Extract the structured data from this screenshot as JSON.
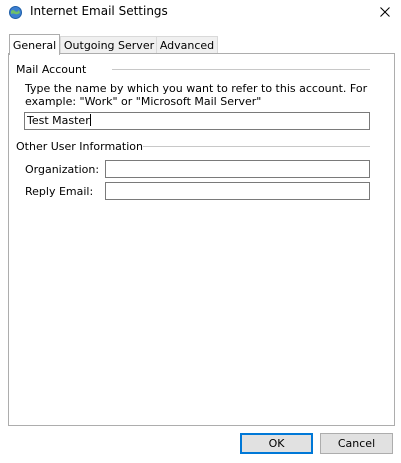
{
  "window": {
    "title": "Internet Email Settings",
    "icon": "globe-mail-icon",
    "close": "close-icon"
  },
  "tabs": [
    {
      "label": "General",
      "active": true
    },
    {
      "label": "Outgoing Server",
      "active": false
    },
    {
      "label": "Advanced",
      "active": false
    }
  ],
  "mail_account": {
    "heading": "Mail Account",
    "description": "Type the name by which you want to refer to this account. For example: \"Work\" or \"Microsoft Mail Server\"",
    "account_name_value": "Test Master"
  },
  "other_user_info": {
    "heading": "Other User Information",
    "organization_label": "Organization:",
    "organization_value": "",
    "reply_email_label": "Reply Email:",
    "reply_email_value": ""
  },
  "buttons": {
    "ok": "OK",
    "cancel": "Cancel"
  },
  "colors": {
    "accent": "#0078d7",
    "button_face": "#e1e1e1"
  }
}
